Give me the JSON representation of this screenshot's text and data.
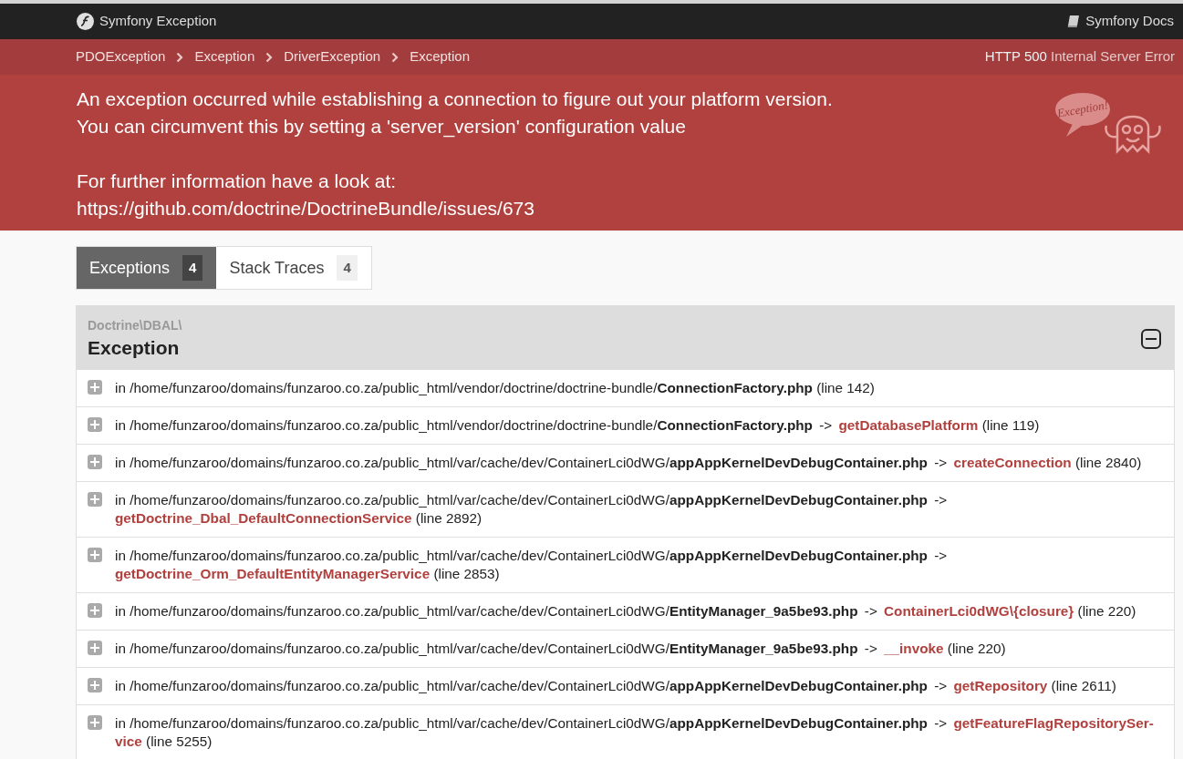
{
  "header": {
    "title": "Symfony Exception",
    "docs_link": "Symfony Docs"
  },
  "breadcrumb": [
    "PDOException",
    "Exception",
    "DriverException",
    "Exception"
  ],
  "status": {
    "code": "HTTP 500",
    "text": "Internal Server Error"
  },
  "message": [
    [
      "An exception occurred while establishing a connection to figure out your platform version.",
      "You can circumvent this by setting a 'server_version' configuration value"
    ],
    [
      "For further information have a look at:",
      "https://github.com/doctrine/DoctrineBundle/issues/673"
    ]
  ],
  "mascot": {
    "bubble": "Exception!"
  },
  "tabs": [
    {
      "label": "Exceptions",
      "count": "4",
      "selected": true
    },
    {
      "label": "Stack Traces",
      "count": "4",
      "selected": false
    }
  ],
  "exception": {
    "namespace": "Doctrine\\DBAL\\",
    "class": "Exception",
    "expanded": true,
    "trace": [
      {
        "expanded": false,
        "prefix": "in /home/funzaroo/domains/funzaroo.co.za/public_html/vendor/doctrine/doctrine-bundle/",
        "file": "ConnectionFactory.php",
        "line": "(line 142)"
      },
      {
        "expanded": false,
        "prefix": "in /home/funzaroo/domains/funzaroo.co.za/public_html/vendor/doctrine/doctrine-bundle/",
        "file": "ConnectionFactory.php",
        "arrow": "->",
        "function": "getDatabasePlatform",
        "line": "(line 119)"
      },
      {
        "expanded": false,
        "prefix": "in /home/funzaroo/domains/funzaroo.co.za/public_html/var/cache/dev/ContainerLci0dWG/",
        "file": "appAppKernelDevDebugContainer.php",
        "arrow": "->",
        "function": "createConnection",
        "line": "(line 2840)"
      },
      {
        "expanded": false,
        "prefix": "in /home/funzaroo/domains/funzaroo.co.za/public_html/var/cache/dev/ContainerLci0dWG/",
        "file": "appAppKernelDevDebugContainer.php",
        "arrow": "->",
        "function": "getDoctrine_Dbal_DefaultConnectionService",
        "line": "(line 2892)"
      },
      {
        "expanded": false,
        "prefix": "in /home/funzaroo/domains/funzaroo.co.za/public_html/var/cache/dev/ContainerLci0dWG/",
        "file": "appAppKernelDevDebugContainer.php",
        "arrow": "->",
        "function": "getDoctrine_Orm_DefaultEntityManagerService",
        "line": "(line 2853)"
      },
      {
        "expanded": false,
        "prefix": "in /home/funzaroo/domains/funzaroo.co.za/public_html/var/cache/dev/ContainerLci0dWG/",
        "file": "EntityManager_9a5be93.php",
        "arrow": "->",
        "function": "ContainerLci0dWG\\{closure}",
        "line": "(line 220)"
      },
      {
        "expanded": false,
        "prefix": "in /home/funzaroo/domains/funzaroo.co.za/public_html/var/cache/dev/ContainerLci0dWG/",
        "file": "EntityManager_9a5be93.php",
        "arrow": "->",
        "function": "__invoke",
        "line": "(line 220)"
      },
      {
        "expanded": false,
        "prefix": "in /home/funzaroo/domains/funzaroo.co.za/public_html/var/cache/dev/ContainerLci0dWG/",
        "file": "appAppKernelDevDebugContainer.php",
        "arrow": "->",
        "function": "getRepository",
        "line": "(line 2611)"
      },
      {
        "expanded": false,
        "prefix": "in /home/funzaroo/domains/funzaroo.co.za/public_html/var/cache/dev/ContainerLci0dWG/",
        "file": "appAppKernelDevDebugContainer.php",
        "arrow": "->",
        "function": "getFeatureFlagRepositorySer-",
        "function_continued": "vice",
        "line": "(line 5255)"
      }
    ]
  }
}
